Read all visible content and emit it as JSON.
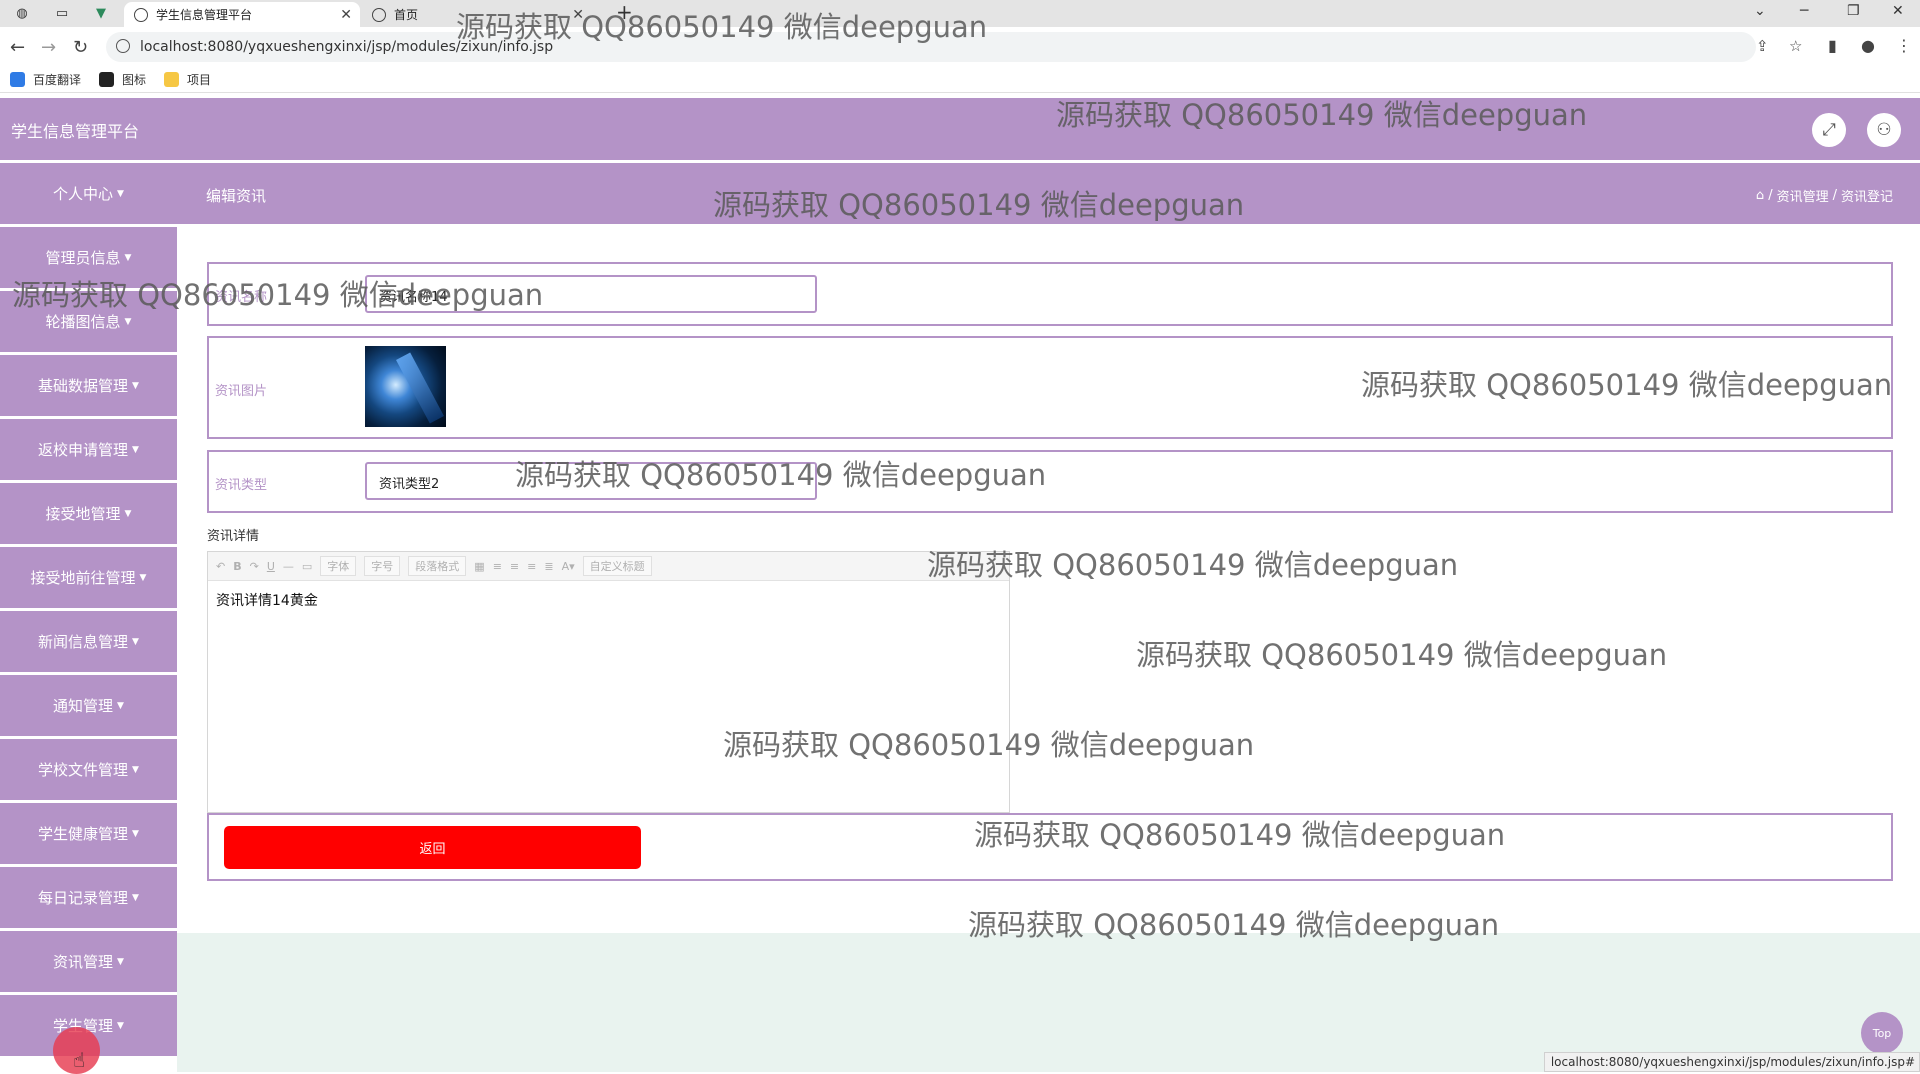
{
  "browser": {
    "tabs": [
      {
        "label": "学生信息管理平台",
        "active": true
      },
      {
        "label": "首页",
        "active": false
      }
    ],
    "url": "localhost:8080/yqxueshengxinxi/jsp/modules/zixun/info.jsp",
    "bookmarks": [
      "百度翻译",
      "图标",
      "项目"
    ],
    "status_url": "localhost:8080/yqxueshengxinxi/jsp/modules/zixun/info.jsp#"
  },
  "app": {
    "brand": "学生信息管理平台",
    "page_title": "编辑资讯",
    "breadcrumb": [
      "资讯管理",
      "资讯登记"
    ],
    "accent_color": "#b493c7",
    "sidebar": [
      "个人中心",
      "管理员信息",
      "轮播图信息",
      "基础数据管理",
      "返校申请管理",
      "接受地管理",
      "接受地前往管理",
      "新闻信息管理",
      "通知管理",
      "学校文件管理",
      "学生健康管理",
      "每日记录管理",
      "资讯管理",
      "学生管理"
    ],
    "form": {
      "name_label": "资讯名称",
      "name_value": "资讯名称14",
      "image_label": "资讯图片",
      "type_label": "资讯类型",
      "type_value": "资讯类型2",
      "detail_label": "资讯详情",
      "detail_text": "资讯详情14黄金",
      "toolbar_font": "字体",
      "toolbar_size": "字号",
      "toolbar_para": "段落格式",
      "toolbar_custom": "自定义标题"
    },
    "back_button": "返回",
    "top_button": "Top"
  },
  "watermark": "源码获取 QQ86050149 微信deepguan"
}
